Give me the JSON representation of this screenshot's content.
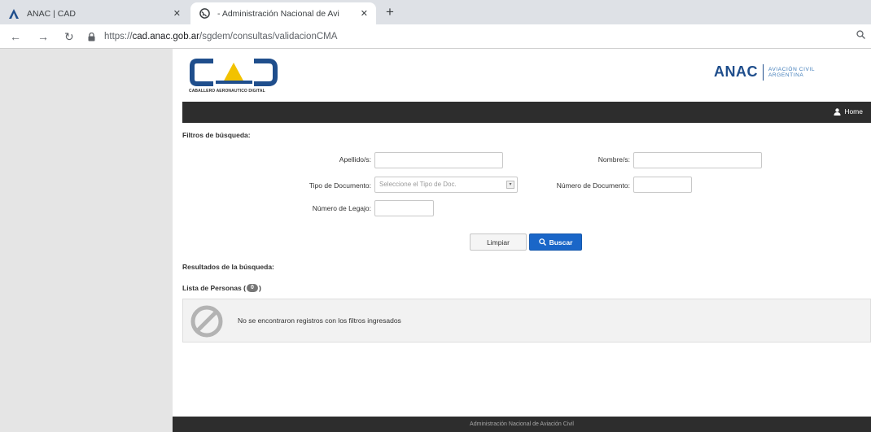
{
  "browser": {
    "tabs": [
      {
        "title": "ANAC | CAD",
        "icon": "anac-logo-icon",
        "active": false
      },
      {
        "title": "- Administración Nacional de Avi",
        "icon": "globe-icon",
        "active": true
      }
    ],
    "new_tab_label": "+",
    "url_scheme": "https://",
    "url_host": "cad.anac.gob.ar",
    "url_path": "/sgdem/consultas/validacionCMA"
  },
  "header": {
    "cad_logo_tagline": "CABALLERO AERONAUTICO DIGITAL",
    "anac_mark": "ANAC",
    "anac_sub_line1": "AVIACIÓN CIVIL",
    "anac_sub_line2": "ARGENTINA"
  },
  "navbar": {
    "home_label": "Home"
  },
  "filters": {
    "heading": "Filtros de búsqueda:",
    "apellido_label": "Apellido/s:",
    "nombre_label": "Nombre/s:",
    "tipo_doc_label": "Tipo de Documento:",
    "tipo_doc_placeholder": "Seleccione el Tipo de Doc.",
    "num_doc_label": "Número de Documento:",
    "legajo_label": "Número de Legajo:",
    "clear_label": "Limpiar",
    "search_label": "Buscar"
  },
  "results": {
    "heading": "Resultados de la búsqueda:",
    "list_label": "Lista de Personas (",
    "list_label_end": ")",
    "count": "0",
    "empty_message": "No se encontraron registros con los filtros ingresados"
  },
  "footer": {
    "text": "Administración Nacional de Aviación Civil"
  },
  "colors": {
    "navbar": "#2d2d2d",
    "primary_button": "#1a66c8",
    "anac_blue": "#1f4e8c"
  }
}
